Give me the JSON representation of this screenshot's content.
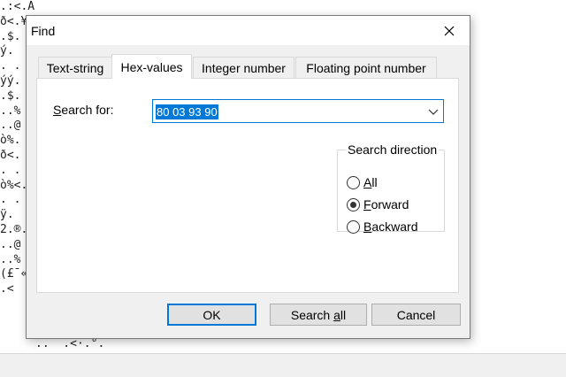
{
  "background": {
    "hex_text_lines": [
      ".:<.Ap%...",
      "ð<.¥¤%€",
      ".$.",
      "ý.",
      ". . .",
      "ýý.",
      ".$.",
      "..%",
      "..@",
      "ò%.",
      "ð<.",
      ". . .",
      "ò%<.",
      ". . .",
      "ÿ.",
      "2.®.",
      "..@",
      "..%",
      "(£¯«",
      ".<"
    ],
    "hex_text_tail": "..  .<·.°."
  },
  "dialog": {
    "title": "Find",
    "tabs": [
      {
        "label": "Text-string",
        "active": false
      },
      {
        "label": "Hex-values",
        "active": true
      },
      {
        "label": "Integer number",
        "active": false
      },
      {
        "label": "Floating point number",
        "active": false
      }
    ],
    "search_label_first": "S",
    "search_label_rest": "earch for:",
    "search_value": "80 03 93 90",
    "direction": {
      "legend": "Search direction",
      "options": [
        {
          "first": "A",
          "rest": "ll",
          "checked": false
        },
        {
          "first": "F",
          "rest": "orward",
          "checked": true
        },
        {
          "first": "B",
          "rest": "ackward",
          "checked": false
        }
      ]
    },
    "buttons": {
      "ok": "OK",
      "search_all_pre": "Search ",
      "search_all_u": "a",
      "search_all_post": "ll",
      "cancel": "Cancel"
    }
  }
}
